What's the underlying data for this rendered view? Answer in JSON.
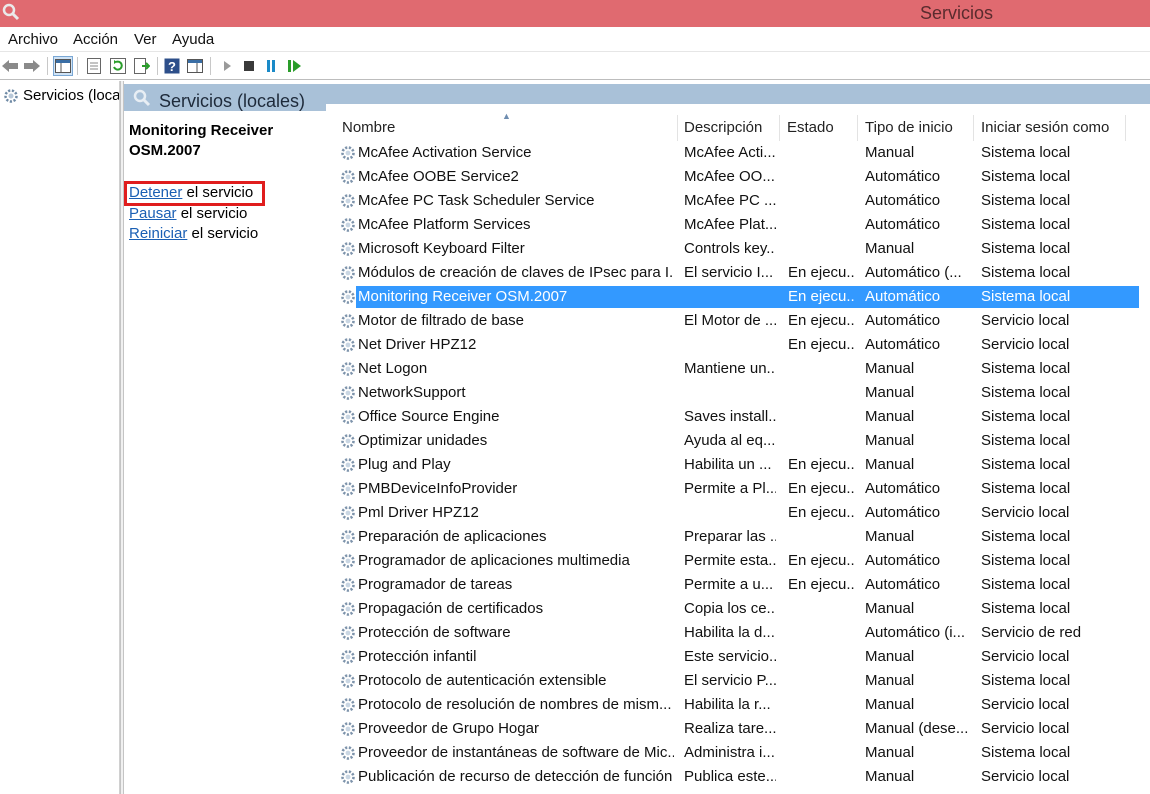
{
  "window": {
    "title": "Servicios"
  },
  "menu": [
    "Archivo",
    "Acción",
    "Ver",
    "Ayuda"
  ],
  "tree": {
    "item_label": "Servicios (loca"
  },
  "header": {
    "title": "Servicios (locales)"
  },
  "detail": {
    "service_name": "Monitoring Receiver OSM.2007",
    "actions": [
      {
        "link": "Detener",
        "rest": " el servicio"
      },
      {
        "link": "Pausar",
        "rest": " el servicio"
      },
      {
        "link": "Reiniciar",
        "rest": " el servicio"
      }
    ]
  },
  "columns": [
    "Nombre",
    "Descripción",
    "Estado",
    "Tipo de inicio",
    "Iniciar sesión como"
  ],
  "selected_index": 6,
  "rows": [
    {
      "name": "McAfee Activation Service",
      "desc": "McAfee Acti...",
      "state": "",
      "start": "Manual",
      "logon": "Sistema local"
    },
    {
      "name": "McAfee OOBE Service2",
      "desc": "McAfee OO...",
      "state": "",
      "start": "Automático",
      "logon": "Sistema local"
    },
    {
      "name": "McAfee PC Task Scheduler Service",
      "desc": "McAfee PC ...",
      "state": "",
      "start": "Automático",
      "logon": "Sistema local"
    },
    {
      "name": "McAfee Platform Services",
      "desc": "McAfee Plat...",
      "state": "",
      "start": "Automático",
      "logon": "Sistema local"
    },
    {
      "name": "Microsoft Keyboard Filter",
      "desc": "Controls key...",
      "state": "",
      "start": "Manual",
      "logon": "Sistema local"
    },
    {
      "name": "Módulos de creación de claves de IPsec para I...",
      "desc": "El servicio I...",
      "state": "En ejecu...",
      "start": "Automático (...",
      "logon": "Sistema local"
    },
    {
      "name": "Monitoring Receiver OSM.2007",
      "desc": "",
      "state": "En ejecu...",
      "start": "Automático",
      "logon": "Sistema local"
    },
    {
      "name": "Motor de filtrado de base",
      "desc": "El Motor de ...",
      "state": "En ejecu...",
      "start": "Automático",
      "logon": "Servicio local"
    },
    {
      "name": "Net Driver HPZ12",
      "desc": "",
      "state": "En ejecu...",
      "start": "Automático",
      "logon": "Servicio local"
    },
    {
      "name": "Net Logon",
      "desc": "Mantiene un...",
      "state": "",
      "start": "Manual",
      "logon": "Sistema local"
    },
    {
      "name": "NetworkSupport",
      "desc": "",
      "state": "",
      "start": "Manual",
      "logon": "Sistema local"
    },
    {
      "name": "Office  Source Engine",
      "desc": "Saves install...",
      "state": "",
      "start": "Manual",
      "logon": "Sistema local"
    },
    {
      "name": "Optimizar unidades",
      "desc": "Ayuda al eq...",
      "state": "",
      "start": "Manual",
      "logon": "Sistema local"
    },
    {
      "name": "Plug and Play",
      "desc": "Habilita un ...",
      "state": "En ejecu...",
      "start": "Manual",
      "logon": "Sistema local"
    },
    {
      "name": "PMBDeviceInfoProvider",
      "desc": "Permite a Pl...",
      "state": "En ejecu...",
      "start": "Automático",
      "logon": "Sistema local"
    },
    {
      "name": "Pml Driver HPZ12",
      "desc": "",
      "state": "En ejecu...",
      "start": "Automático",
      "logon": "Servicio local"
    },
    {
      "name": "Preparación de aplicaciones",
      "desc": "Preparar las ...",
      "state": "",
      "start": "Manual",
      "logon": "Sistema local"
    },
    {
      "name": "Programador de aplicaciones multimedia",
      "desc": "Permite esta...",
      "state": "En ejecu...",
      "start": "Automático",
      "logon": "Sistema local"
    },
    {
      "name": "Programador de tareas",
      "desc": "Permite a u...",
      "state": "En ejecu...",
      "start": "Automático",
      "logon": "Sistema local"
    },
    {
      "name": "Propagación de certificados",
      "desc": "Copia los ce...",
      "state": "",
      "start": "Manual",
      "logon": "Sistema local"
    },
    {
      "name": "Protección de software",
      "desc": "Habilita la d...",
      "state": "",
      "start": "Automático (i...",
      "logon": "Servicio de red"
    },
    {
      "name": "Protección infantil",
      "desc": "Este servicio...",
      "state": "",
      "start": "Manual",
      "logon": "Servicio local"
    },
    {
      "name": "Protocolo de autenticación extensible",
      "desc": "El servicio P...",
      "state": "",
      "start": "Manual",
      "logon": "Sistema local"
    },
    {
      "name": "Protocolo de resolución de nombres de mism...",
      "desc": "Habilita la r...",
      "state": "",
      "start": "Manual",
      "logon": "Servicio local"
    },
    {
      "name": "Proveedor de Grupo Hogar",
      "desc": "Realiza tare...",
      "state": "",
      "start": "Manual (dese...",
      "logon": "Servicio local"
    },
    {
      "name": "Proveedor de instantáneas de software de Mic...",
      "desc": "Administra i...",
      "state": "",
      "start": "Manual",
      "logon": "Sistema local"
    },
    {
      "name": "Publicación de recurso de detección de función",
      "desc": "Publica este...",
      "state": "",
      "start": "Manual",
      "logon": "Servicio local"
    }
  ],
  "colors": {
    "titlebar": "#e06a70",
    "header_band": "#a9c1d8",
    "selection": "#3399ff",
    "highlight": "#e01d1d",
    "link": "#1a5fb4"
  }
}
